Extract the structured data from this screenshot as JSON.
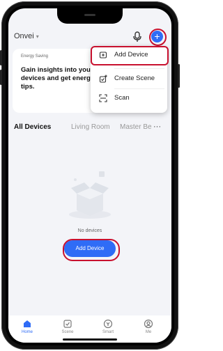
{
  "header": {
    "home_name": "Onvei",
    "caret": "▾",
    "mic_icon": "microphone-icon",
    "add_icon": "plus-icon",
    "plus_glyph": "+"
  },
  "banner": {
    "label": "Energy Saving",
    "text": "Gain insights into your devices and get energy tips."
  },
  "tabs": [
    "All Devices",
    "Living Room",
    "Master Be"
  ],
  "tabs_more": "···",
  "empty_state": {
    "message": "No devices",
    "button_label": "Add Device"
  },
  "dropdown": {
    "items": [
      {
        "label": "Add Device",
        "icon": "add-device-icon"
      },
      {
        "label": "Create Scene",
        "icon": "create-scene-icon"
      },
      {
        "label": "Scan",
        "icon": "scan-icon"
      }
    ]
  },
  "bottom_nav": {
    "items": [
      {
        "label": "Home",
        "icon": "home-icon",
        "active": true
      },
      {
        "label": "Scene",
        "icon": "scene-icon",
        "active": false
      },
      {
        "label": "Smart",
        "icon": "smart-icon",
        "active": false
      },
      {
        "label": "Me",
        "icon": "profile-icon",
        "active": false
      }
    ]
  },
  "colors": {
    "accent": "#2f6cf6",
    "highlight": "#c8102e",
    "background": "#f3f4f8"
  }
}
